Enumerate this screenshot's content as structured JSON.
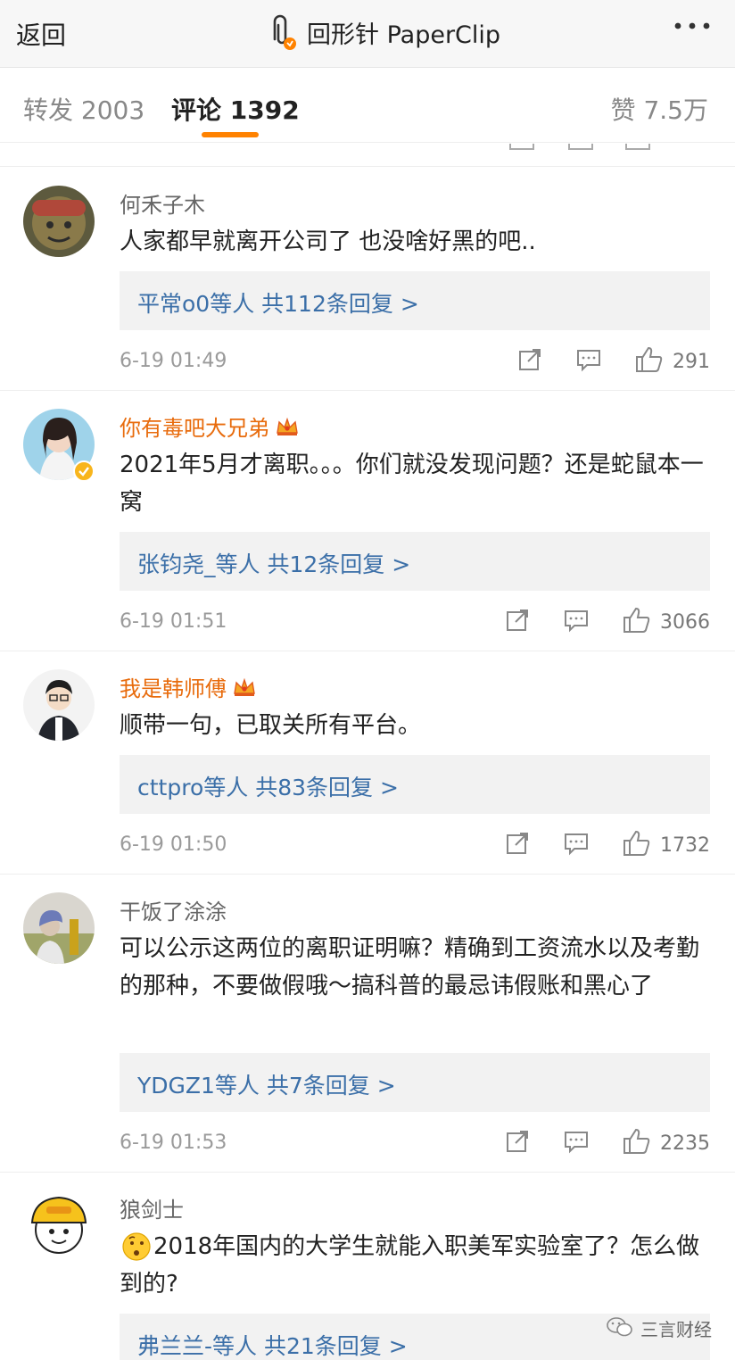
{
  "header": {
    "back_label": "返回",
    "title": "回形针 PaperClip",
    "more_icon": "more-dots-icon"
  },
  "tabs": {
    "repost": "转发 2003",
    "comments": "评论 1392",
    "likes": "赞 7.5万",
    "accent": "#ff8200"
  },
  "comments": [
    {
      "user": "何禾子木",
      "vip": false,
      "text": "人家都早就离开公司了 也没啥好黑的吧..",
      "reply": "平常o0等人  共112条回复 >",
      "time": "6-19 01:49",
      "likes": "291"
    },
    {
      "user": "你有毒吧大兄弟",
      "vip": true,
      "text": "2021年5月才离职。。。你们就没发现问题？还是蛇鼠本一窝",
      "reply": "张钧尧_等人  共12条回复 >",
      "time": "6-19 01:51",
      "likes": "3066"
    },
    {
      "user": "我是韩师傅",
      "vip": true,
      "text": "顺带一句，已取关所有平台。",
      "reply": "cttpro等人  共83条回复 >",
      "time": "6-19 01:50",
      "likes": "1732"
    },
    {
      "user": "干饭了涂涂",
      "vip": false,
      "text": "可以公示这两位的离职证明嘛？精确到工资流水以及考勤的那种，不要做假哦～搞科普的最忌讳假账和黑心了",
      "reply": "YDGZ1等人  共7条回复 >",
      "time": "6-19 01:53",
      "likes": "2235"
    },
    {
      "user": "狼剑士",
      "vip": false,
      "text": "2018年国内的大学生就能入职美军实验室了？怎么做到的?",
      "reply": "弗兰兰-等人  共21条回复 >",
      "time": "",
      "likes": ""
    }
  ],
  "watermark": "三言财经",
  "colors": {
    "vip_name": "#e86b0c",
    "reply_link": "#3b6fa8",
    "meta": "#9a9a9a"
  }
}
